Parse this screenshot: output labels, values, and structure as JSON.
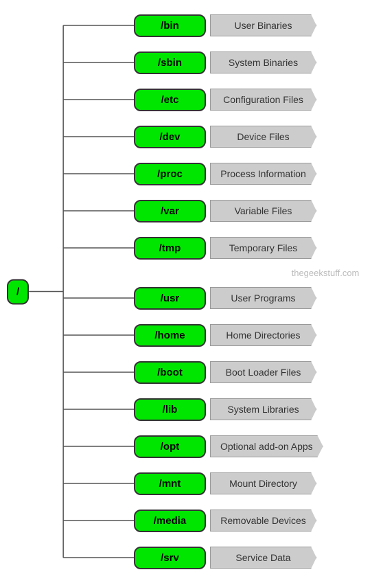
{
  "root": {
    "label": "/"
  },
  "rows": [
    {
      "node": "/bin",
      "label": "User Binaries"
    },
    {
      "node": "/sbin",
      "label": "System Binaries"
    },
    {
      "node": "/etc",
      "label": "Configuration Files"
    },
    {
      "node": "/dev",
      "label": "Device Files"
    },
    {
      "node": "/proc",
      "label": "Process Information"
    },
    {
      "node": "/var",
      "label": "Variable Files"
    },
    {
      "node": "/tmp",
      "label": "Temporary Files"
    },
    {
      "node": "/usr",
      "label": "User Programs"
    },
    {
      "node": "/home",
      "label": "Home Directories"
    },
    {
      "node": "/boot",
      "label": "Boot Loader Files"
    },
    {
      "node": "/lib",
      "label": "System Libraries"
    },
    {
      "node": "/opt",
      "label": "Optional add-on Apps"
    },
    {
      "node": "/mnt",
      "label": "Mount Directory"
    },
    {
      "node": "/media",
      "label": "Removable Devices"
    },
    {
      "node": "/srv",
      "label": "Service Data"
    }
  ],
  "watermark": "thegeekstuff.com",
  "colors": {
    "node_bg": "#00e600",
    "node_border": "#333",
    "label_bg": "#cccccc",
    "label_border": "#999999",
    "line_color": "#555"
  }
}
